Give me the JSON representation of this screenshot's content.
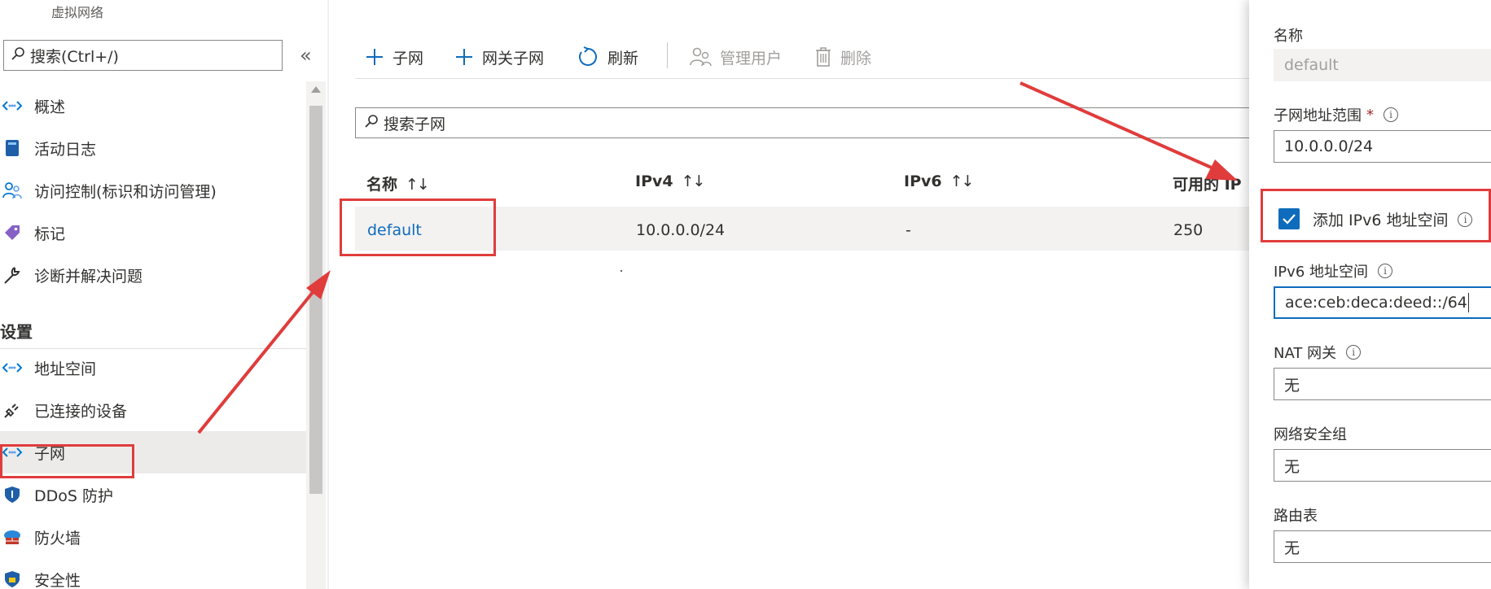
{
  "nav": {
    "resource_type": "虚拟网络",
    "search_placeholder": "搜索(Ctrl+/)",
    "collapse_glyph": "«",
    "section_settings": "设置",
    "items": [
      {
        "label": "概述",
        "icon": "network-icon"
      },
      {
        "label": "活动日志",
        "icon": "log-icon"
      },
      {
        "label": "访问控制(标识和访问管理)",
        "icon": "people-icon"
      },
      {
        "label": "标记",
        "icon": "tag-icon"
      },
      {
        "label": "诊断并解决问题",
        "icon": "wrench-icon"
      },
      {
        "label": "地址空间",
        "icon": "network-icon"
      },
      {
        "label": "已连接的设备",
        "icon": "plug-icon"
      },
      {
        "label": "子网",
        "icon": "network-icon",
        "selected": true
      },
      {
        "label": "DDoS 防护",
        "icon": "shield-icon"
      },
      {
        "label": "防火墙",
        "icon": "firewall-icon"
      },
      {
        "label": "安全性",
        "icon": "shield-icon"
      }
    ]
  },
  "toolbar": {
    "add_subnet": "子网",
    "add_gateway_subnet": "网关子网",
    "refresh": "刷新",
    "manage_users": "管理用户",
    "delete": "删除"
  },
  "subnet_search": {
    "placeholder": "搜索子网"
  },
  "table": {
    "columns": [
      "名称",
      "IPv4",
      "IPv6",
      "可用的 IP"
    ],
    "sort_glyph": "↑↓",
    "rows": [
      {
        "name": "default",
        "ipv4": "10.0.0.0/24",
        "ipv6": "-",
        "available_ips": "250"
      }
    ]
  },
  "panel": {
    "name_label": "名称",
    "name_value": "default",
    "range_label": "子网地址范围",
    "required_mark": "*",
    "range_value": "10.0.0.0/24",
    "ipv6_checkbox_label": "添加 IPv6 地址空间",
    "ipv6_checked": true,
    "ipv6_space_label": "IPv6 地址空间",
    "ipv6_space_value": "ace:ceb:deca:deed::/64",
    "nat_label": "NAT 网关",
    "nat_value": "无",
    "nsg_label": "网络安全组",
    "nsg_value": "无",
    "route_label": "路由表",
    "route_value": "无",
    "info_glyph": "i"
  },
  "colors": {
    "accent": "#0f6cbd",
    "annotation": "#e03c3c",
    "selected_row": "#f3f2f1"
  }
}
